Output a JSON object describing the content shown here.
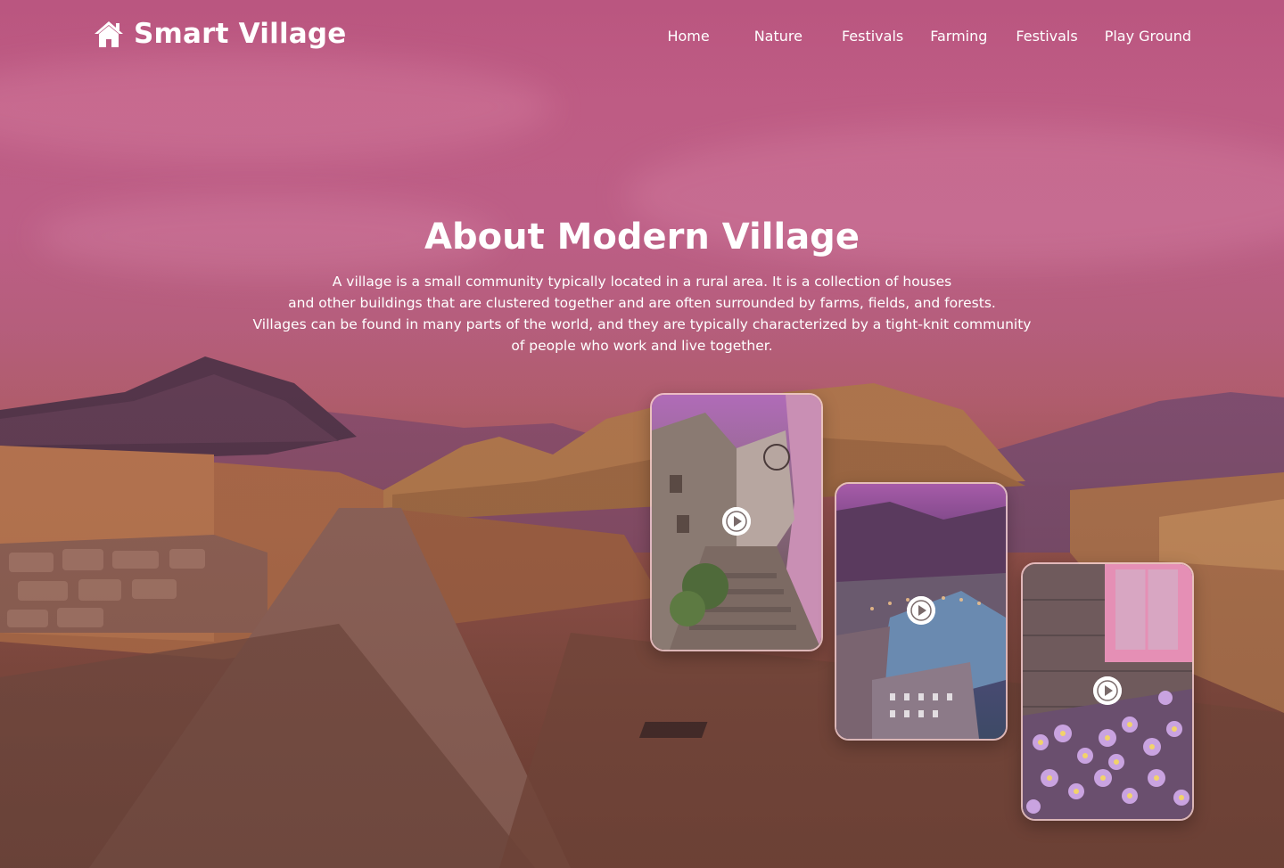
{
  "header": {
    "logo_text": "Smart Village",
    "logo_icon": "home-icon",
    "nav": [
      {
        "label": "Home"
      },
      {
        "label": "Nature"
      },
      {
        "label": "Festivals"
      },
      {
        "label": "Farming"
      },
      {
        "label": "Festivals"
      },
      {
        "label": "Play Ground"
      }
    ]
  },
  "hero": {
    "title": "About Modern Village",
    "description_lines": [
      "A village is a small community typically located in a rural area. It is a collection of houses",
      "and other buildings that are clustered together and are often surrounded by farms, fields, and forests.",
      "Villages can be found in many parts of the world, and they are typically characterized by a tight-knit community",
      "of people who work and live together."
    ]
  },
  "videos": [
    {
      "scene": "stone-alley-village",
      "icon": "play-icon"
    },
    {
      "scene": "river-town-at-dusk",
      "icon": "play-icon"
    },
    {
      "scene": "purple-flowers-by-window",
      "icon": "play-icon"
    }
  ],
  "colors": {
    "sky": "#c0628a",
    "ground": "#744437",
    "text": "#ffffff",
    "card_border": "#ffdce1"
  }
}
